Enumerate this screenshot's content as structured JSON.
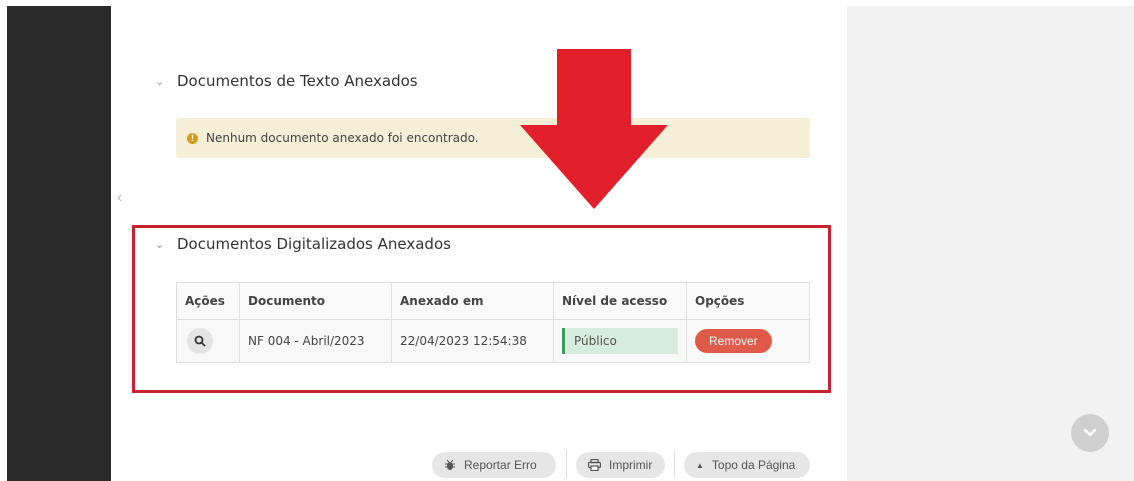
{
  "sections": {
    "text_docs": {
      "title": "Documentos de Texto Anexados"
    },
    "alert": {
      "message": "Nenhum documento anexado foi encontrado."
    },
    "scanned_docs": {
      "title": "Documentos Digitalizados Anexados",
      "columns": [
        "Ações",
        "Documento",
        "Anexado em",
        "Nível de acesso",
        "Opções"
      ],
      "rows": [
        {
          "document": "NF 004 - Abril/2023",
          "attached_at": "22/04/2023 12:54:38",
          "access_level": "Público",
          "option_label": "Remover"
        }
      ]
    }
  },
  "footer": {
    "report_error": "Reportar Erro",
    "print": "Imprimir",
    "top_of_page": "Topo da Página"
  },
  "colors": {
    "highlight_box": "#c8232c",
    "arrow": "#e2202b",
    "remove_button": "#e05a4a",
    "public_badge": "#d6ecdc",
    "alert_bg": "#f4efd6"
  },
  "icons": {
    "alert": "exclamation-circle-icon",
    "view": "search-icon",
    "report": "bug-icon",
    "print": "printer-icon",
    "top": "caret-up-icon",
    "scroll": "chevron-down-icon"
  }
}
